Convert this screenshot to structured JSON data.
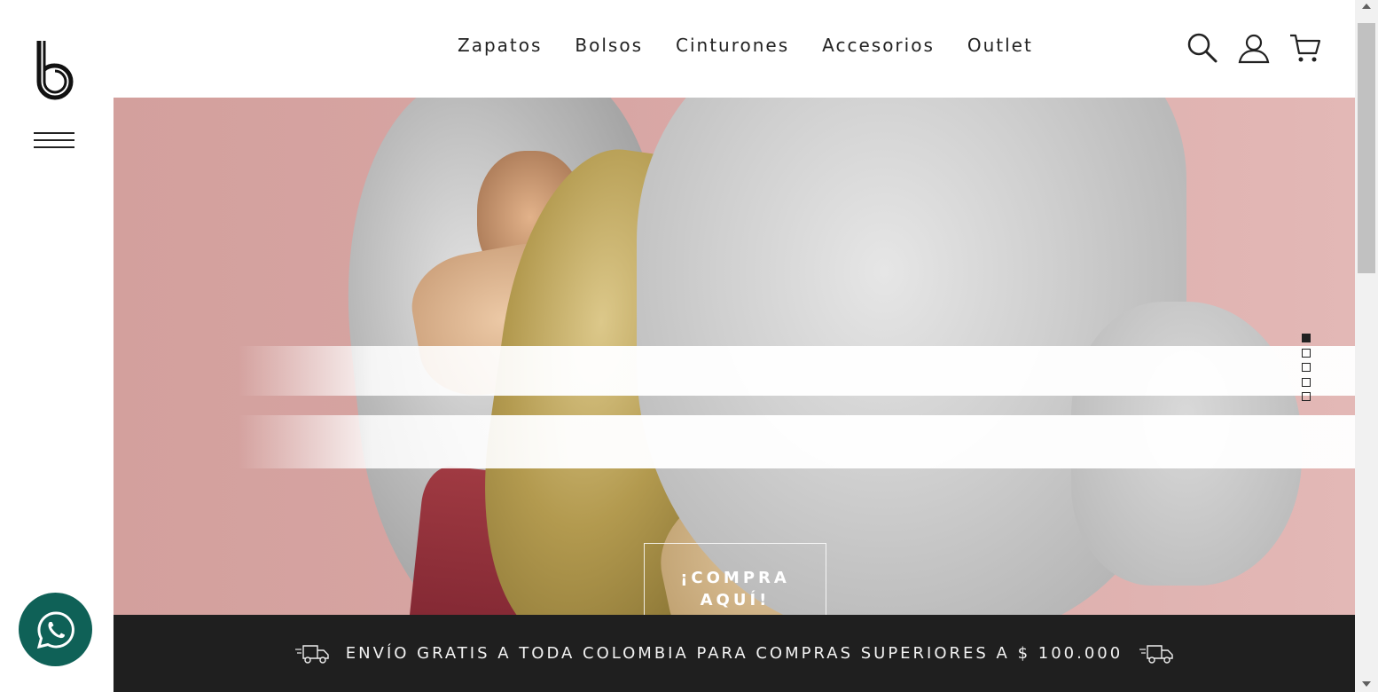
{
  "brand": {
    "logo_icon": "b-logo-icon"
  },
  "header": {
    "nav": [
      {
        "label": "Zapatos"
      },
      {
        "label": "Bolsos"
      },
      {
        "label": "Cinturones"
      },
      {
        "label": "Accesorios"
      },
      {
        "label": "Outlet"
      }
    ],
    "icons": [
      "search-icon",
      "user-icon",
      "cart-icon"
    ]
  },
  "hero": {
    "cta_line1": "¡COMPRA",
    "cta_line2": "AQUÍ!",
    "slides_total": 5,
    "active_slide": 1
  },
  "shipping": {
    "text": "ENVÍO GRATIS A TODA COLOMBIA PARA COMPRAS SUPERIORES A $ 100.000",
    "icon": "delivery-truck-icon"
  },
  "whatsapp": {
    "icon": "whatsapp-icon"
  },
  "colors": {
    "hero_bg": "#d8a6a4",
    "banner_bg": "#1f1f1f",
    "whatsapp_bg": "#0f6157",
    "text": "#222222"
  }
}
